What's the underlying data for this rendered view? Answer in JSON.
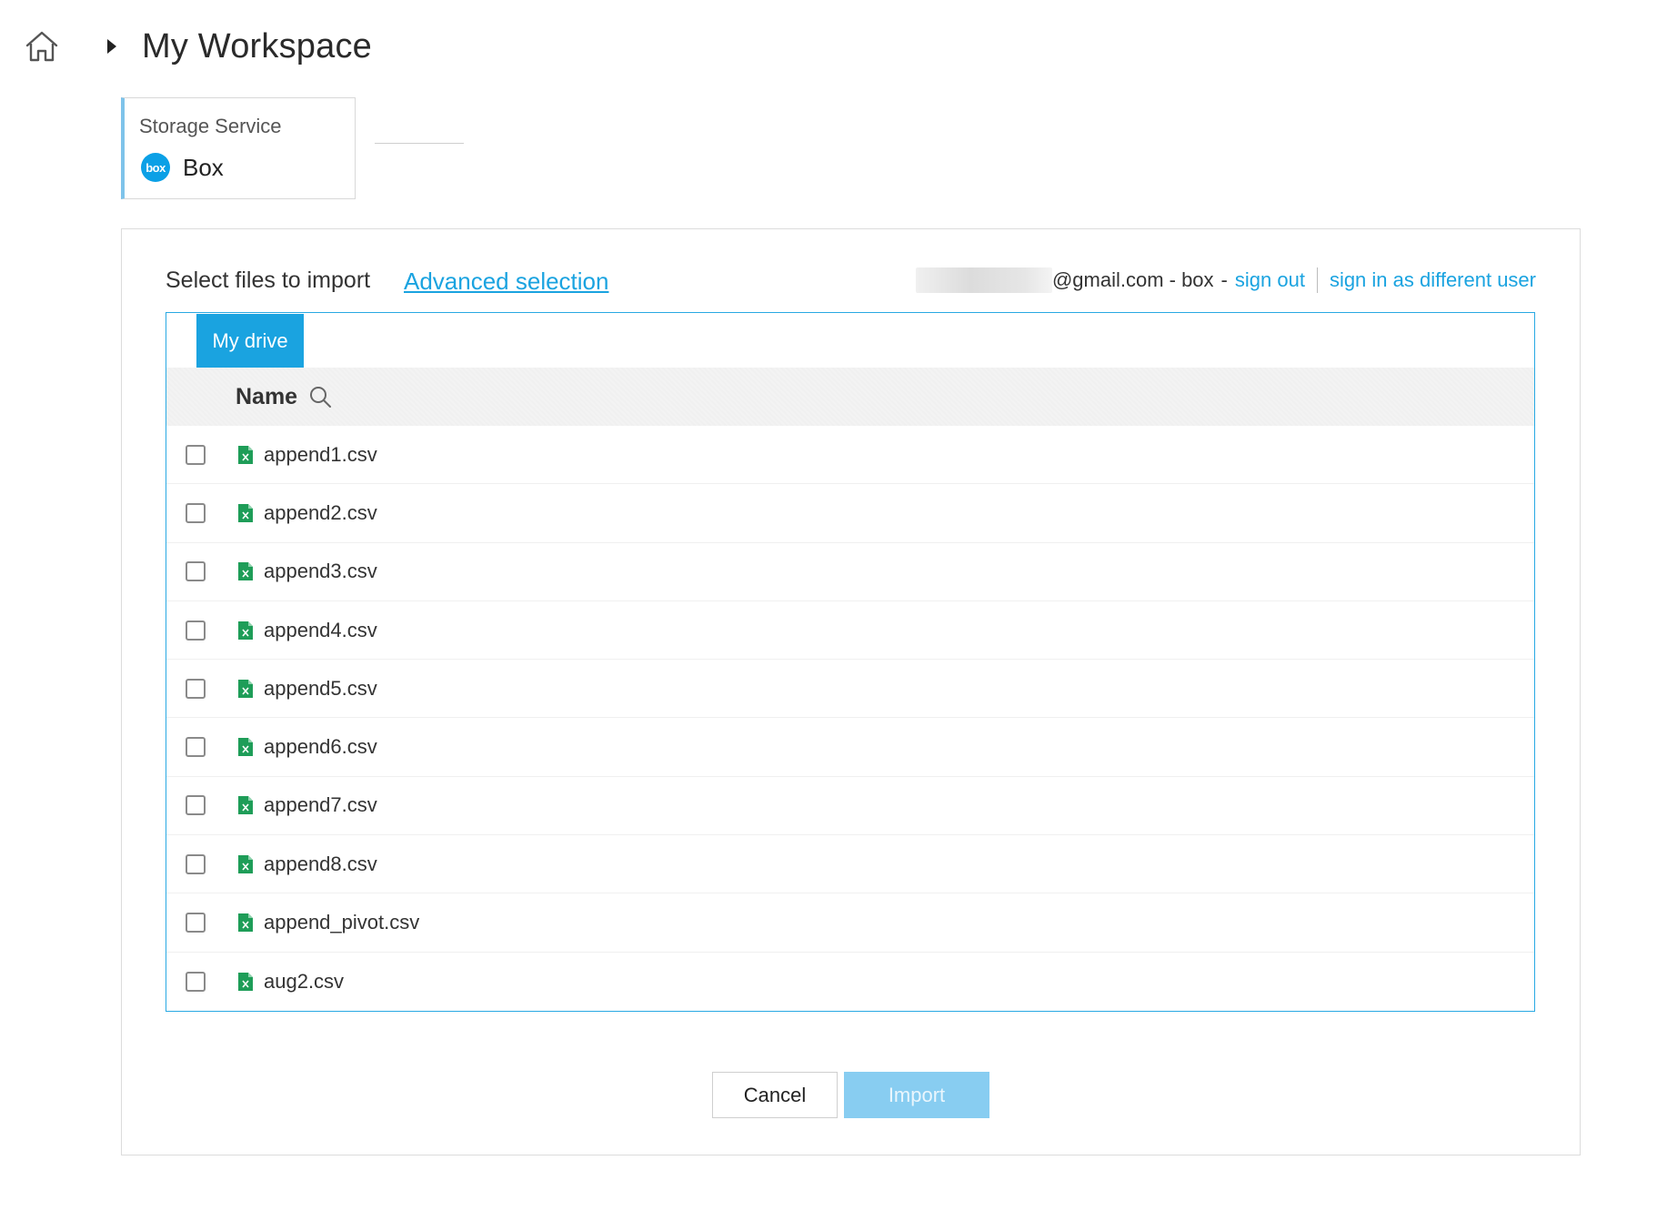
{
  "header": {
    "title": "My Workspace",
    "home_icon": "home-icon",
    "separator_icon": "caret-right-icon"
  },
  "service": {
    "label": "Storage Service",
    "name": "Box",
    "logo_text": "box",
    "logo_color": "#0ba0e6"
  },
  "panel": {
    "select_title": "Select files to import",
    "advanced_link": "Advanced selection",
    "account": {
      "email_suffix": "@gmail.com - box",
      "separator": "-",
      "sign_out": "sign out",
      "sign_in_different": "sign in as different user"
    }
  },
  "browser": {
    "tab_label": "My drive",
    "column_header": "Name",
    "files": [
      {
        "name": "append1.csv",
        "checked": false
      },
      {
        "name": "append2.csv",
        "checked": false
      },
      {
        "name": "append3.csv",
        "checked": false
      },
      {
        "name": "append4.csv",
        "checked": false
      },
      {
        "name": "append5.csv",
        "checked": false
      },
      {
        "name": "append6.csv",
        "checked": false
      },
      {
        "name": "append7.csv",
        "checked": false
      },
      {
        "name": "append8.csv",
        "checked": false
      },
      {
        "name": "append_pivot.csv",
        "checked": false
      },
      {
        "name": "aug2.csv",
        "checked": false
      }
    ]
  },
  "actions": {
    "cancel": "Cancel",
    "import": "Import"
  },
  "colors": {
    "accent": "#1aa3e0",
    "import_disabled": "#88cdf1",
    "spreadsheet_icon": "#1e9d58"
  }
}
